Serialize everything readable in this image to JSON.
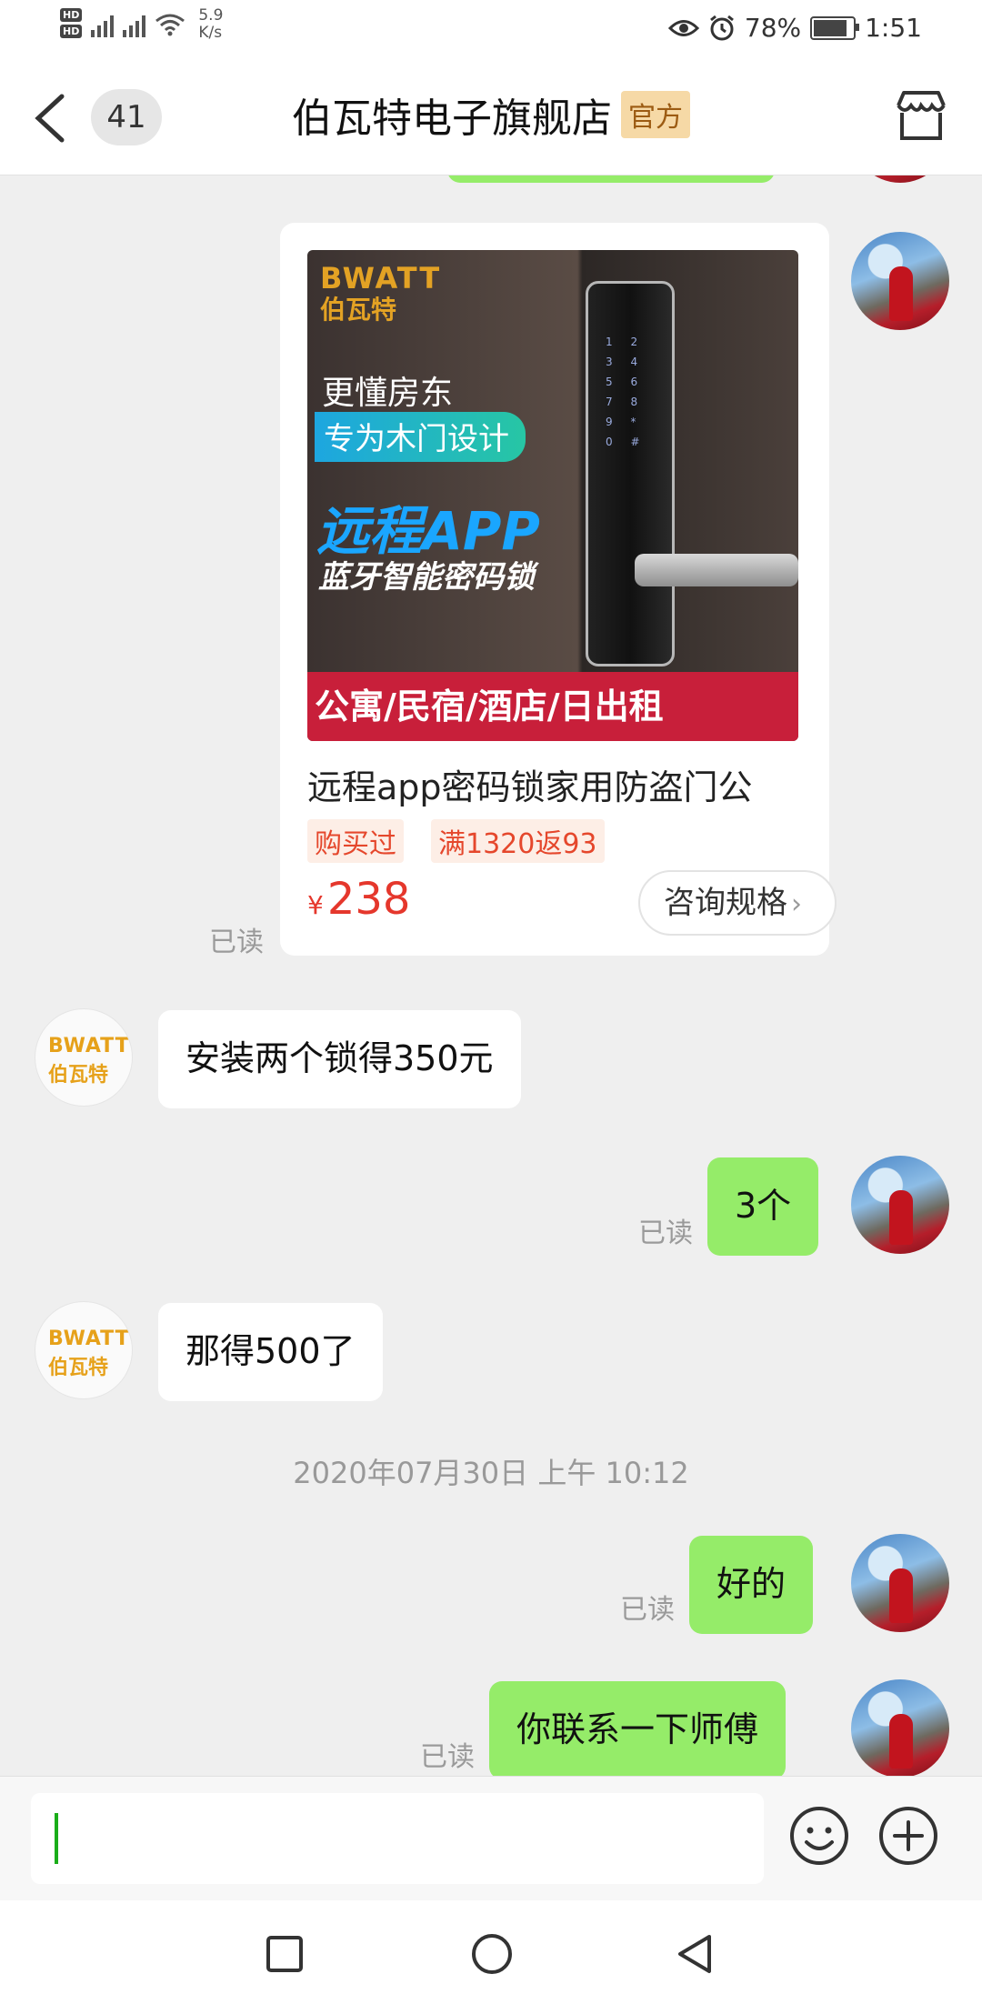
{
  "status_bar": {
    "network_speed": "5.9",
    "network_unit": "K/s",
    "battery": "78%",
    "time": "1:51",
    "hd1": "HD",
    "hd2": "HD"
  },
  "nav": {
    "unread_count": "41",
    "title": "伯瓦特电子旗舰店",
    "official_badge": "官方"
  },
  "product_card": {
    "image": {
      "brand_en": "BWATT",
      "brand_cn": "伯瓦特",
      "line1": "更懂房东",
      "line2": "专为木门设计",
      "line3": "远程APP",
      "line4": "蓝牙智能密码锁",
      "line5": "公寓/民宿/酒店/日出租",
      "keypad": "1 2 3 4 5 6 7 8 9 * 0 #"
    },
    "name": "远程app密码锁家用防盗门公",
    "tag_bought": "购买过",
    "tag_promo": "满1320返93",
    "currency": "¥",
    "price": "238",
    "spec_button": "咨询规格",
    "read_label": "已读"
  },
  "store_avatar": {
    "line1": "BWATT",
    "line2": "伯瓦特"
  },
  "messages": [
    {
      "from": "store",
      "text": "安装两个锁得350元"
    },
    {
      "from": "me",
      "text": "3个",
      "read": "已读"
    },
    {
      "from": "store",
      "text": "那得500了"
    },
    {
      "from": "me",
      "text": "好的",
      "read": "已读"
    },
    {
      "from": "me",
      "text": "你联系一下师傅",
      "read": "已读"
    }
  ],
  "timestamp": "2020年07月30日 上午 10:12",
  "input": {
    "value": ""
  },
  "icons": {
    "back": "back-arrow-icon",
    "shop": "shop-icon",
    "emoji": "emoji-icon",
    "plus": "plus-icon",
    "eye": "eye-icon",
    "alarm": "alarm-icon",
    "wifi": "wifi-icon"
  },
  "colors": {
    "bubble_out": "#95ec69",
    "price": "#e5372c",
    "official_bg": "#f6d9a6"
  }
}
